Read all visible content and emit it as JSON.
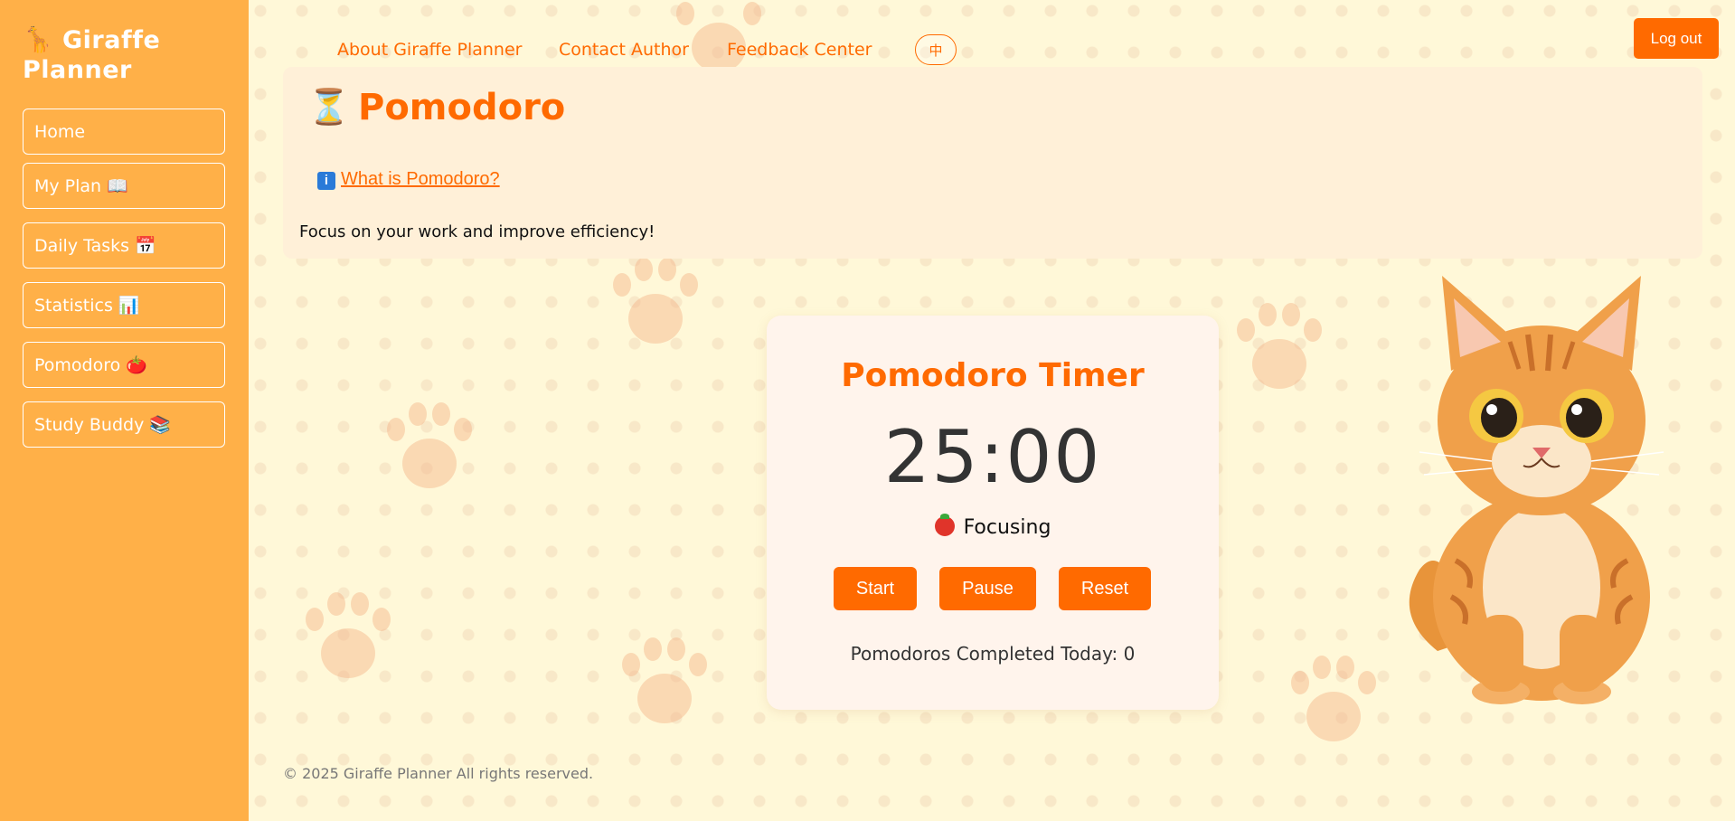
{
  "app": {
    "brand_line1": "🦒 Giraffe",
    "brand_line2": "Planner"
  },
  "sidebar": {
    "items": [
      {
        "label": "Home"
      },
      {
        "label": "My Plan 📖"
      },
      {
        "label": "Daily Tasks 📅"
      },
      {
        "label": "Statistics 📊"
      },
      {
        "label": "Pomodoro 🍅"
      },
      {
        "label": "Study Buddy 📚"
      }
    ]
  },
  "topnav": {
    "about": "About Giraffe Planner",
    "contact": "Contact Author",
    "feedback": "Feedback Center",
    "lang": "中",
    "logout": "Log out"
  },
  "header": {
    "icon": "⏳",
    "title": "Pomodoro",
    "info_icon": "i",
    "info_link": "What is Pomodoro?",
    "tagline": "Focus on your work and improve efficiency!"
  },
  "timer": {
    "title": "Pomodoro Timer",
    "time": "25:00",
    "status": "Focusing",
    "start": "Start",
    "pause": "Pause",
    "reset": "Reset",
    "completed_label": "Pomodoros Completed Today: 0"
  },
  "footer": {
    "text": "© 2025 Giraffe Planner All rights reserved."
  },
  "colors": {
    "sidebar": "#ffb048",
    "accent": "#ff6a00",
    "background": "#fff8d8",
    "panel": "#fff0d8"
  },
  "icons": [
    "giraffe-icon",
    "hourglass-icon",
    "info-icon",
    "tomato-icon",
    "cat-illustration"
  ]
}
